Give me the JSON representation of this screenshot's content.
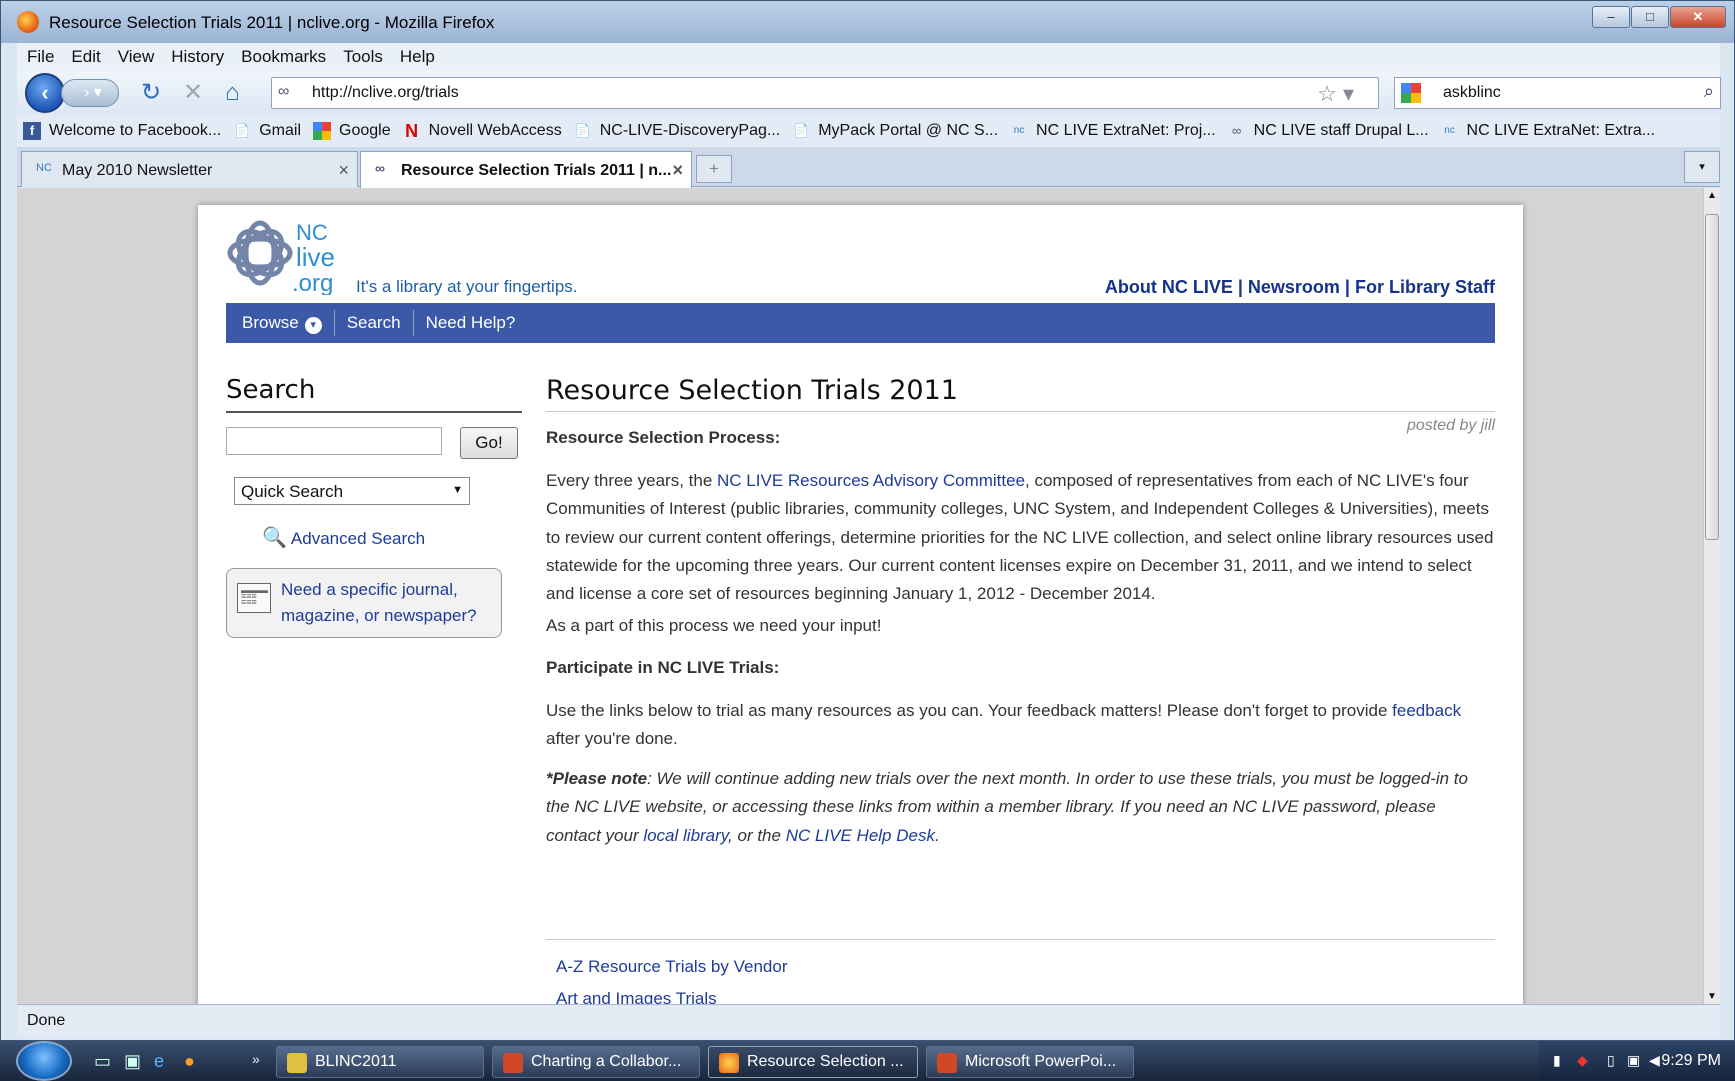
{
  "window": {
    "title": "Resource Selection Trials 2011 | nclive.org - Mozilla Firefox",
    "min": "–",
    "max": "□",
    "close": "✕"
  },
  "menu": [
    "File",
    "Edit",
    "View",
    "History",
    "Bookmarks",
    "Tools",
    "Help"
  ],
  "nav": {
    "url": "http://nclive.org/trials",
    "search_value": "askblinc",
    "back_icon": "arrow-left",
    "reload": "↻",
    "stop": "✕",
    "home": "⌂"
  },
  "bookmarks": [
    {
      "icon": "f",
      "label": "Welcome to Facebook..."
    },
    {
      "icon": "📄",
      "label": "Gmail"
    },
    {
      "icon": "g",
      "label": "Google"
    },
    {
      "icon": "N",
      "label": "Novell WebAccess"
    },
    {
      "icon": "📄",
      "label": "NC-LIVE-DiscoveryPag..."
    },
    {
      "icon": "📄",
      "label": "MyPack Portal @ NC S..."
    },
    {
      "icon": "nc",
      "label": "NC LIVE ExtraNet: Proj..."
    },
    {
      "icon": "∞",
      "label": "NC LIVE staff Drupal L..."
    },
    {
      "icon": "nc",
      "label": "NC LIVE ExtraNet: Extra..."
    }
  ],
  "tabs": [
    {
      "label": "May 2010 Newsletter",
      "close": "×"
    },
    {
      "label": "Resource Selection Trials 2011 | n...",
      "close": "×"
    }
  ],
  "tabs_misc": {
    "new_tab": "+",
    "scroll": "▾"
  },
  "site": {
    "logo_line1": "NC",
    "logo_line2": "live",
    "logo_line3": ".org",
    "tagline": "It's a library at your fingertips.",
    "top_links": {
      "about": "About NC LIVE",
      "sep1": " | ",
      "news": "Newsroom",
      "sep2": " | ",
      "staff": "For Library Staff"
    },
    "nav": {
      "browse": "Browse",
      "search": "Search",
      "help": "Need Help?"
    }
  },
  "sidebar": {
    "heading": "Search",
    "go": "Go!",
    "quick_search": "Quick Search",
    "advanced": "Advanced Search",
    "need_line1": "Need a specific journal,",
    "need_line2": "magazine, or newspaper?"
  },
  "article": {
    "title": "Resource Selection Trials 2011",
    "posted": "posted by jill",
    "h1": "Resource Selection Process:",
    "p1_a": "Every three years, the ",
    "p1_link": "NC LIVE Resources Advisory Committee",
    "p1_b": ", composed of representatives from each of NC LIVE's four Communities of Interest (public libraries, community colleges, UNC System, and Independent Colleges & Universities), meets to review our current content offerings,  determine priorities for the NC LIVE collection, and select online library resources used statewide for the upcoming three years.  Our current content licenses expire on December 31, 2011, and we intend to select and license a core set of resources beginning January 1, 2012 - December 2014.",
    "p2": "As a part of this process we need your input!",
    "h2": "Participate in NC LIVE Trials:",
    "p3_a": "Use the links below to trial as many resources as you can.  Your feedback matters! Please don't forget to provide ",
    "p3_link": "feedback",
    "p3_b": " after you're done.",
    "note_bold": "*Please note",
    "note_a": ": We will continue adding new trials over the next month. In order to use these trials, you must be logged-in to the NC LIVE website, or accessing these links from within a member library.  If you need an NC LIVE password, please contact your ",
    "note_link1": "local library",
    "note_b": ", or the ",
    "note_link2": "NC LIVE Help Desk",
    "note_c": ".",
    "links": [
      "A-Z Resource Trials by Vendor",
      "Art and Images Trials"
    ]
  },
  "status": "Done",
  "taskbar": {
    "items": [
      "BLINC2011",
      "Charting a Collabor...",
      "Resource Selection ...",
      "Microsoft PowerPoi..."
    ],
    "chevron": "»",
    "clock": "9:29 PM"
  }
}
